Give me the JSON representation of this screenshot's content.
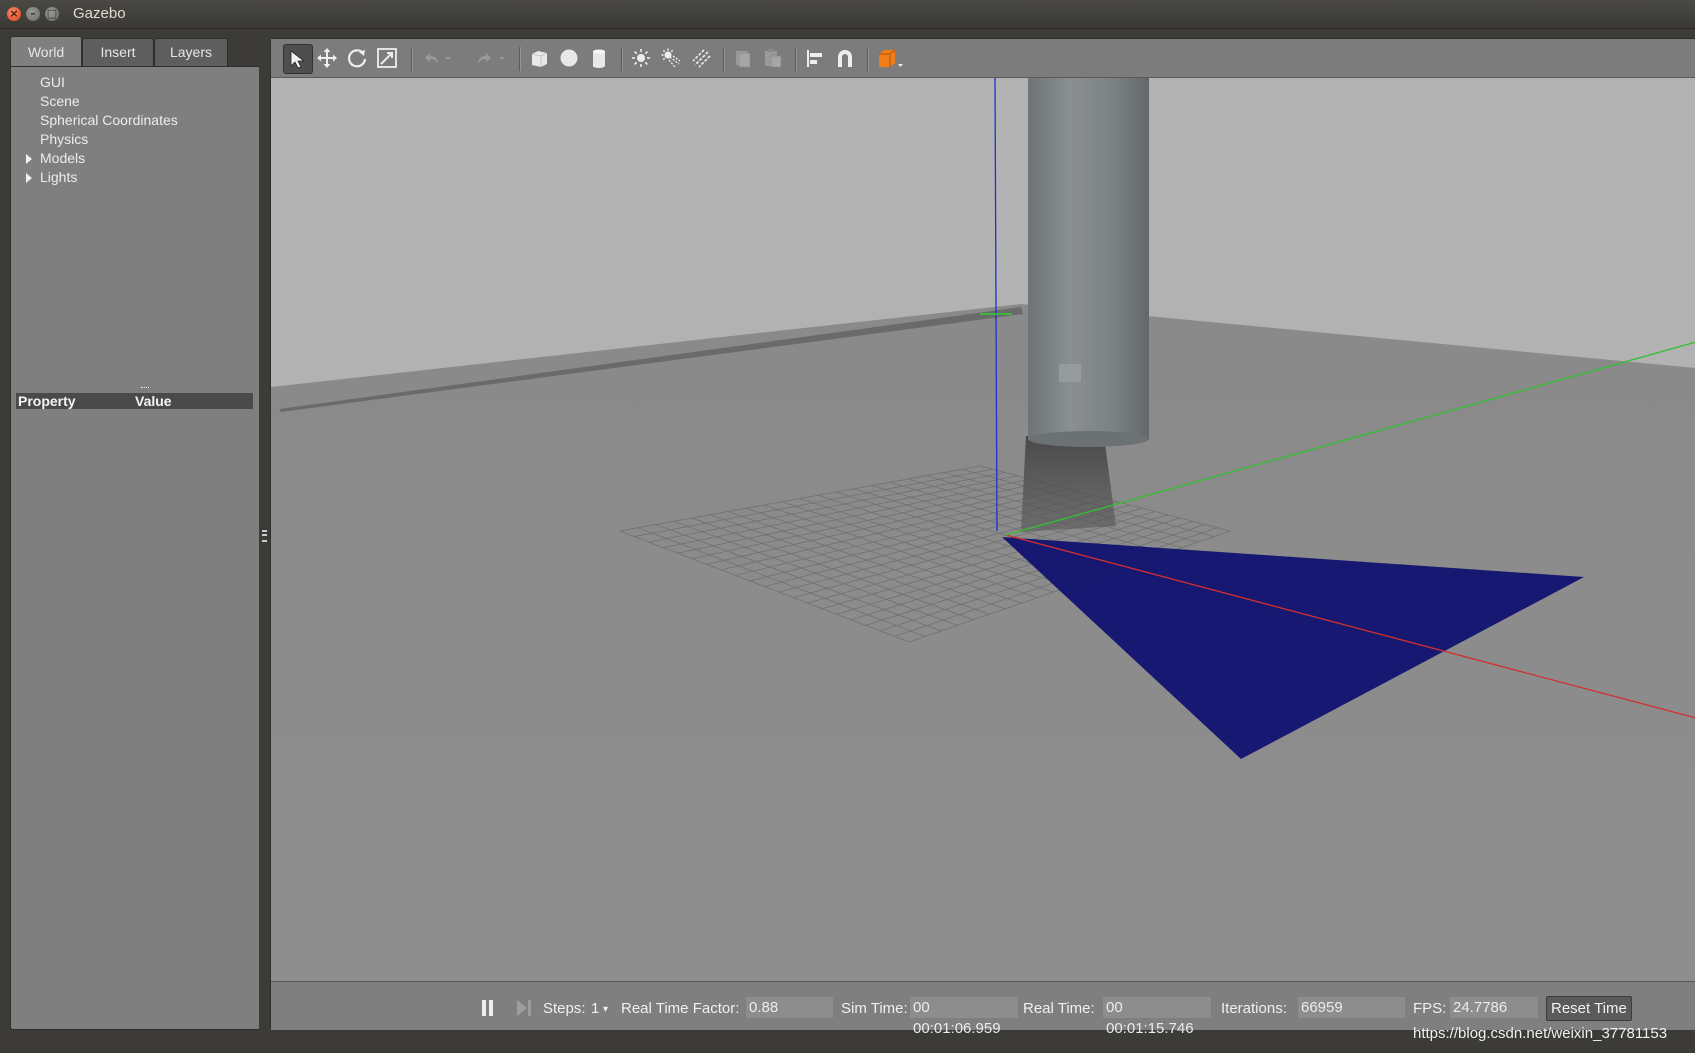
{
  "window": {
    "title": "Gazebo"
  },
  "left_panel": {
    "tabs": [
      "World",
      "Insert",
      "Layers"
    ],
    "active_tab": "World",
    "tree": [
      {
        "label": "GUI",
        "expandable": false
      },
      {
        "label": "Scene",
        "expandable": false
      },
      {
        "label": "Spherical Coordinates",
        "expandable": false
      },
      {
        "label": "Physics",
        "expandable": false
      },
      {
        "label": "Models",
        "expandable": true
      },
      {
        "label": "Lights",
        "expandable": true
      }
    ],
    "property_table": {
      "col_property": "Property",
      "col_value": "Value"
    }
  },
  "toolbar": {
    "tools": [
      {
        "icon": "select-arrow-icon",
        "active": true
      },
      {
        "icon": "translate-icon"
      },
      {
        "icon": "rotate-icon"
      },
      {
        "icon": "scale-icon"
      },
      {
        "icon": "undo-icon",
        "disabled": true
      },
      {
        "icon": "undo-dropdown-icon",
        "disabled": true
      },
      {
        "icon": "redo-icon",
        "disabled": true
      },
      {
        "icon": "redo-dropdown-icon",
        "disabled": true
      },
      {
        "icon": "box-shape-icon"
      },
      {
        "icon": "sphere-shape-icon"
      },
      {
        "icon": "cylinder-shape-icon"
      },
      {
        "icon": "point-light-icon"
      },
      {
        "icon": "spot-light-icon"
      },
      {
        "icon": "directional-light-icon"
      },
      {
        "icon": "copy-icon",
        "disabled": true
      },
      {
        "icon": "paste-icon",
        "disabled": true
      },
      {
        "icon": "align-icon"
      },
      {
        "icon": "snap-magnet-icon"
      },
      {
        "icon": "view-angle-cube-icon"
      }
    ]
  },
  "bottom_bar": {
    "steps_label": "Steps:",
    "steps_value": "1",
    "rtf_label": "Real Time Factor:",
    "rtf_value": "0.88",
    "sim_time_label": "Sim Time:",
    "sim_time_value": "00 00:01:06.959",
    "real_time_label": "Real Time:",
    "real_time_value": "00 00:01:15.746",
    "iterations_label": "Iterations:",
    "iterations_value": "66959",
    "fps_label": "FPS:",
    "fps_value": "24.7786",
    "reset_label": "Reset Time"
  },
  "watermark": "https://blog.csdn.net/weixin_37781153",
  "colors": {
    "laser_scan": "#101170",
    "x_axis": "#d03030",
    "y_axis": "#30c030",
    "z_axis": "#2030d0",
    "cylinder": "#7e8486",
    "ground": "#8e8e8e",
    "sky_wall": "#b2b2b2"
  }
}
